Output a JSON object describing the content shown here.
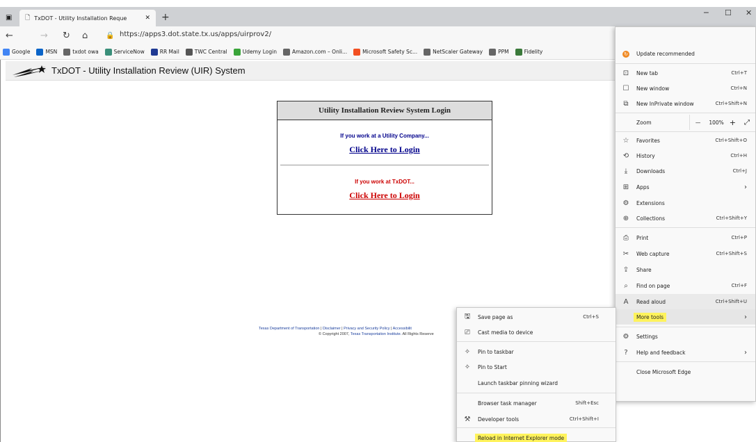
{
  "browser": {
    "tab_title": "TxDOT - Utility Installation Reque",
    "url": "https://apps3.dot.state.tx.us/apps/uirprov2/",
    "bookmarks": [
      {
        "label": "Google",
        "icon": "google-icon",
        "color": "#4285f4"
      },
      {
        "label": "MSN",
        "icon": "msn-icon",
        "color": "#0a64c8"
      },
      {
        "label": "txdot owa",
        "icon": "page-icon",
        "color": "#666666"
      },
      {
        "label": "ServiceNow",
        "icon": "servicenow-icon",
        "color": "#3a8f7a"
      },
      {
        "label": "RR Mail",
        "icon": "play-icon",
        "color": "#1f3a93"
      },
      {
        "label": "TWC Central",
        "icon": "twc-icon",
        "color": "#555555"
      },
      {
        "label": "Udemy Login",
        "icon": "udemy-icon",
        "color": "#3aa53a"
      },
      {
        "label": "Amazon.com – Onli...",
        "icon": "page-icon",
        "color": "#666666"
      },
      {
        "label": "Microsoft Safety Sc...",
        "icon": "microsoft-icon",
        "color": "#f25022"
      },
      {
        "label": "NetScaler Gateway",
        "icon": "page-icon",
        "color": "#666666"
      },
      {
        "label": "PPM",
        "icon": "page-icon",
        "color": "#666666"
      },
      {
        "label": "Fidelity",
        "icon": "fidelity-icon",
        "color": "#3b7a3b"
      }
    ]
  },
  "site": {
    "header_title": "TxDOT - Utility Installation Review (UIR) System",
    "login_title": "Utility Installation Review System Login",
    "utility_prompt": "If you work at a Utility Company...",
    "utility_link": "Click Here to Login",
    "txdot_prompt": "If you work at TxDOT...",
    "txdot_link": "Click Here to Login",
    "footer_line1_a": "Texas Department of Transportation",
    "footer_line1_b": "Disclaimer",
    "footer_line1_c": "Privacy and Security Policy",
    "footer_line1_d": "Accessibilit",
    "footer_line2_a": "© Copyright 2007,",
    "footer_line2_b": "Texas Transportation Institute.",
    "footer_line2_c": "All Rights Reserve"
  },
  "menu": {
    "update": "Update recommended",
    "new_tab": "New tab",
    "new_tab_sc": "Ctrl+T",
    "new_window": "New window",
    "new_window_sc": "Ctrl+N",
    "new_inprivate": "New InPrivate window",
    "new_inprivate_sc": "Ctrl+Shift+N",
    "zoom": "Zoom",
    "zoom_minus": "—",
    "zoom_value": "100%",
    "zoom_plus": "+",
    "favorites": "Favorites",
    "favorites_sc": "Ctrl+Shift+O",
    "history": "History",
    "history_sc": "Ctrl+H",
    "downloads": "Downloads",
    "downloads_sc": "Ctrl+J",
    "apps": "Apps",
    "extensions": "Extensions",
    "collections": "Collections",
    "collections_sc": "Ctrl+Shift+Y",
    "print": "Print",
    "print_sc": "Ctrl+P",
    "web_capture": "Web capture",
    "web_capture_sc": "Ctrl+Shift+S",
    "share": "Share",
    "find": "Find on page",
    "find_sc": "Ctrl+F",
    "read_aloud": "Read aloud",
    "read_aloud_sc": "Ctrl+Shift+U",
    "more_tools": "More tools",
    "settings": "Settings",
    "help": "Help and feedback",
    "close": "Close Microsoft Edge"
  },
  "submenu": {
    "save_page": "Save page as",
    "save_page_sc": "Ctrl+S",
    "cast": "Cast media to device",
    "pin_taskbar": "Pin to taskbar",
    "pin_start": "Pin to Start",
    "launch_wizard": "Launch taskbar pinning wizard",
    "task_manager": "Browser task manager",
    "task_manager_sc": "Shift+Esc",
    "dev_tools": "Developer tools",
    "dev_tools_sc": "Ctrl+Shift+I",
    "ie_mode": "Reload in Internet Explorer mode"
  },
  "colors": {
    "highlight": "#fff35c",
    "link_blue": "#00008b",
    "link_red": "#cc0000",
    "update_orange": "#f08a24"
  }
}
